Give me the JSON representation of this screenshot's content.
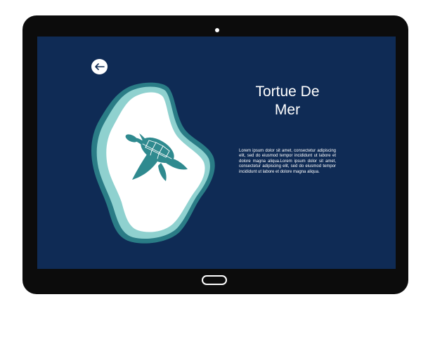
{
  "colors": {
    "frame": "#0c0c0c",
    "screen": "#0f2b55",
    "blob_outer": "#2a7c86",
    "blob_middle": "#8fd1cf",
    "blob_inner": "#ffffff",
    "turtle": "#2f8a8f",
    "text": "#ffffff"
  },
  "back_button": {
    "icon": "arrow-left-icon"
  },
  "illustration": {
    "icon": "sea-turtle-icon"
  },
  "title": "Tortue De Mer",
  "description": "Lorem ipsum dolor sit amet, consectetur adipiscing elit, sed do eiusmod tempor incididunt ut labore et dolore magna aliqua.Lorem ipsum dolor sit amet, consectetur adipiscing elit, sed do eiusmod tempor incididunt ut labore et dolore magna aliqua."
}
